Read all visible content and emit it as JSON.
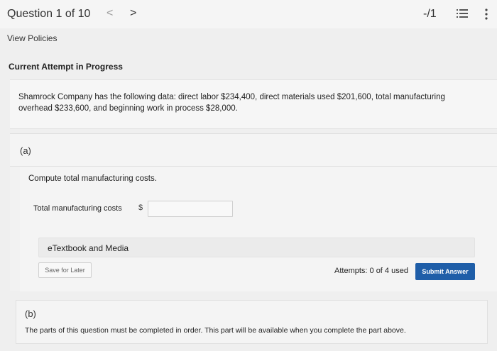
{
  "header": {
    "question_counter": "Question 1 of 10",
    "prev_glyph": "<",
    "next_glyph": ">",
    "score": "-/1"
  },
  "links": {
    "view_policies": "View Policies"
  },
  "attempt": {
    "title": "Current Attempt in Progress"
  },
  "question": {
    "text": "Shamrock Company has the following data: direct labor $234,400, direct materials used $201,600, total manufacturing overhead $233,600, and beginning work in process $28,000."
  },
  "part_a": {
    "label": "(a)",
    "prompt": "Compute total manufacturing costs.",
    "field_label": "Total manufacturing costs",
    "currency": "$",
    "value": "",
    "etextbook_label": "eTextbook and Media",
    "save_label": "Save for Later",
    "attempts": "Attempts: 0 of 4 used",
    "submit_label": "Submit Answer"
  },
  "part_b": {
    "label": "(b)",
    "notice": "The parts of this question must be completed in order. This part will be available when you complete the part above."
  },
  "colors": {
    "primary": "#1f5ea8",
    "background": "#efefef"
  },
  "icons": {
    "list": "list-icon",
    "more": "more-vertical-icon"
  }
}
